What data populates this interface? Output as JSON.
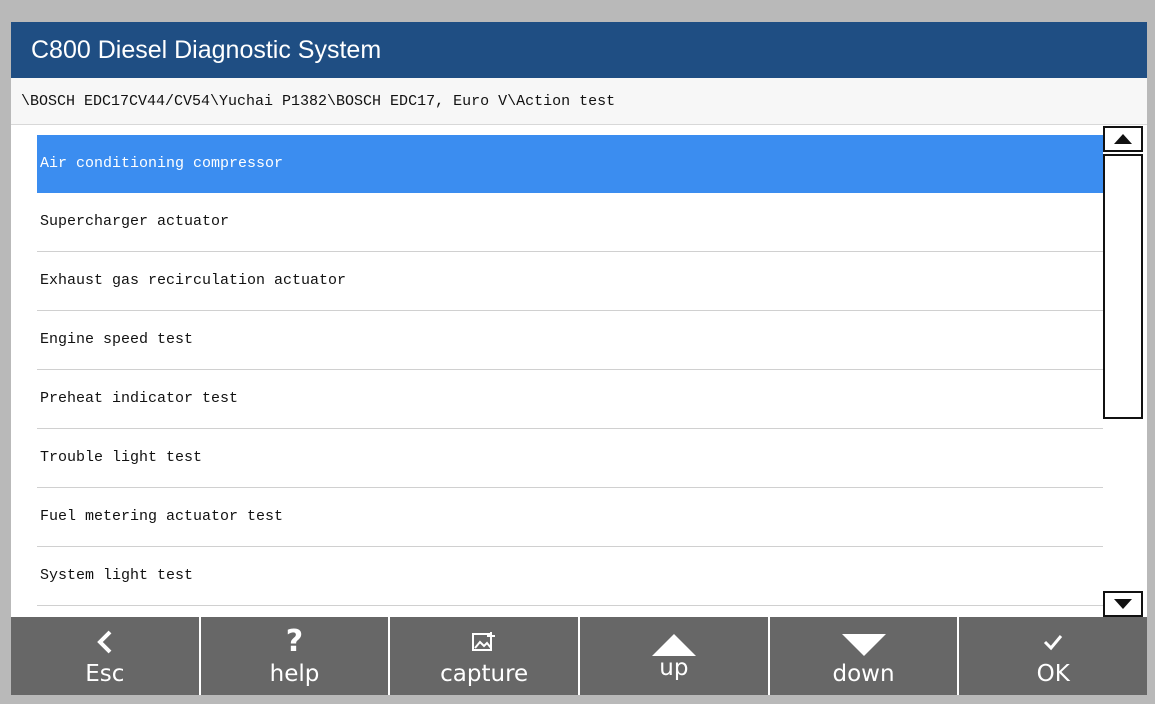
{
  "window": {
    "title": "C800 Diesel Diagnostic System"
  },
  "breadcrumb": "\\BOSCH EDC17CV44/CV54\\Yuchai P1382\\BOSCH EDC17, Euro V\\Action test",
  "list": {
    "selected_index": 0,
    "items": [
      {
        "label": "Air conditioning compressor"
      },
      {
        "label": "Supercharger actuator"
      },
      {
        "label": "Exhaust gas recirculation actuator"
      },
      {
        "label": "Engine speed test"
      },
      {
        "label": "Preheat indicator test"
      },
      {
        "label": "Trouble light test"
      },
      {
        "label": "Fuel metering actuator test"
      },
      {
        "label": "System light test"
      }
    ]
  },
  "toolbar": {
    "buttons": [
      {
        "label": "Esc",
        "icon": "chevron-left-icon"
      },
      {
        "label": "help",
        "icon": "question-icon"
      },
      {
        "label": "capture",
        "icon": "capture-icon"
      },
      {
        "label": "up",
        "icon": "triangle-up-icon"
      },
      {
        "label": "down",
        "icon": "triangle-down-icon"
      },
      {
        "label": "OK",
        "icon": "checkmark-icon"
      }
    ]
  },
  "colors": {
    "title_bar": "#1f4e83",
    "selected_row": "#3b8df0",
    "toolbar": "#676767"
  }
}
